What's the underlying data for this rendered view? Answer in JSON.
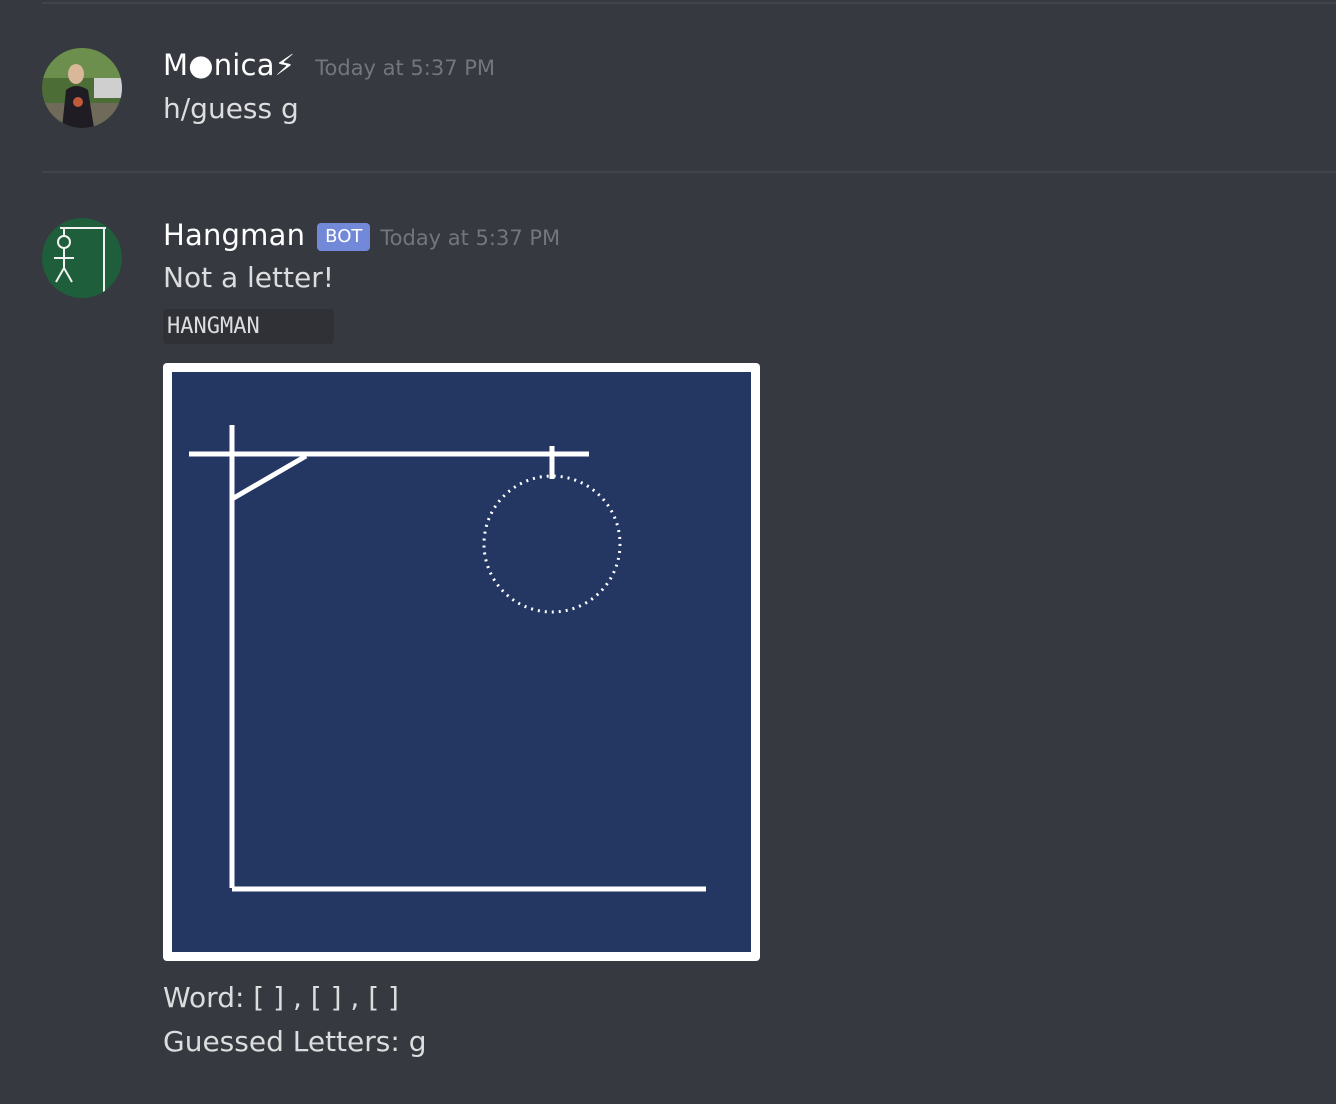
{
  "messages": [
    {
      "username": "M●nica⚡",
      "timestamp": "Today at 5:37 PM",
      "content": "h/guess g"
    },
    {
      "username": "Hangman",
      "bot_tag": "BOT",
      "timestamp": "Today at 5:37 PM",
      "content": "Not a letter!",
      "code_block": "HANGMAN",
      "word_label": "Word:",
      "word_value": " [ ] , [ ] , [ ]",
      "guessed_line": "Guessed Letters: g"
    }
  ],
  "colors": {
    "background": "#36393f",
    "board_bg": "#243763",
    "bot_tag": "#7289da",
    "timestamp": "#72767d"
  }
}
